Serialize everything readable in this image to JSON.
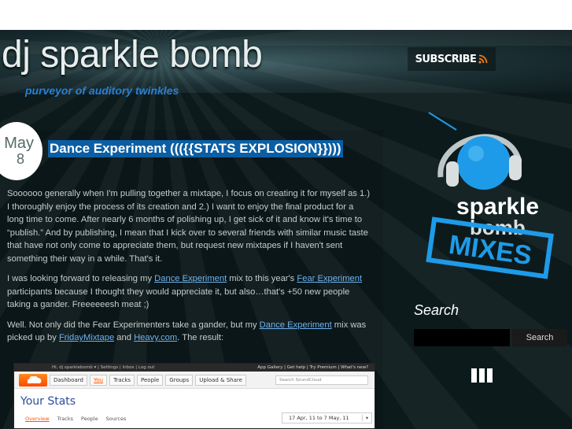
{
  "site": {
    "title": "dj sparkle bomb",
    "tagline": "purveyor of auditory twinkles",
    "subscribe_label": "SUBSCRIBE"
  },
  "post": {
    "date": {
      "month": "May",
      "day": "8"
    },
    "title": "Dance Experiment ((({{STATS EXPLOSION}})))",
    "p1": "Soooooo generally when I'm pulling together a mixtape, I focus on creating it for myself as 1.) I thoroughly enjoy the process of its creation and 2.) I want to enjoy the final product for a long time to come. After nearly 6 months of polishing up, I get sick of it and know it's time to “publish.” And by publishing, I mean that I kick over to several friends with similar music taste that have not only come to appreciate them, but request new mixtapes if I haven't sent something their way in a while. That's it.",
    "p2_a": "I was looking forward to releasing my ",
    "p2_link1": "Dance Experiment",
    "p2_b": " mix to this year's ",
    "p2_link2": "Fear Experiment",
    "p2_c": " participants because I thought they would appreciate it, but also…that's +50 new people taking a gander. Freeeeeesh meat ;)",
    "p3_a": "Well. Not only did the Fear Experimenters take a gander, but my ",
    "p3_link1": "Dance Experiment",
    "p3_b": " mix was picked up by ",
    "p3_link2": "FridayMixtape",
    "p3_c": " and ",
    "p3_link3": "Heavy.com",
    "p3_d": ". The result:"
  },
  "embedded_screenshot": {
    "topbar_left": "Hi, dj sparklebomb ▾ | Settings | Inbox | Log out",
    "topbar_right": "App Gallery | Get help | Try Premium | What's new?",
    "tabs": [
      "Dashboard",
      "You",
      "Tracks",
      "People",
      "Groups",
      "Upload & Share"
    ],
    "active_tab": "You",
    "search_placeholder": "Search SoundCloud",
    "title": "Your Stats",
    "subtabs": [
      "Overview",
      "Tracks",
      "People",
      "Sources"
    ],
    "date_range": "17 Apr, 11 to 7 May, 11"
  },
  "sidebar": {
    "logo_text_1": "sparkle",
    "logo_text_2": "bomb",
    "logo_text_3": "MIXES",
    "search_heading": "Search",
    "search_button_label": "Search"
  },
  "colors": {
    "background": "#0c1a1c",
    "title_highlight": "#0b5ea4",
    "tagline": "#2a7fd0",
    "link": "#6fb3ef",
    "logo_blue": "#1e9be8"
  }
}
